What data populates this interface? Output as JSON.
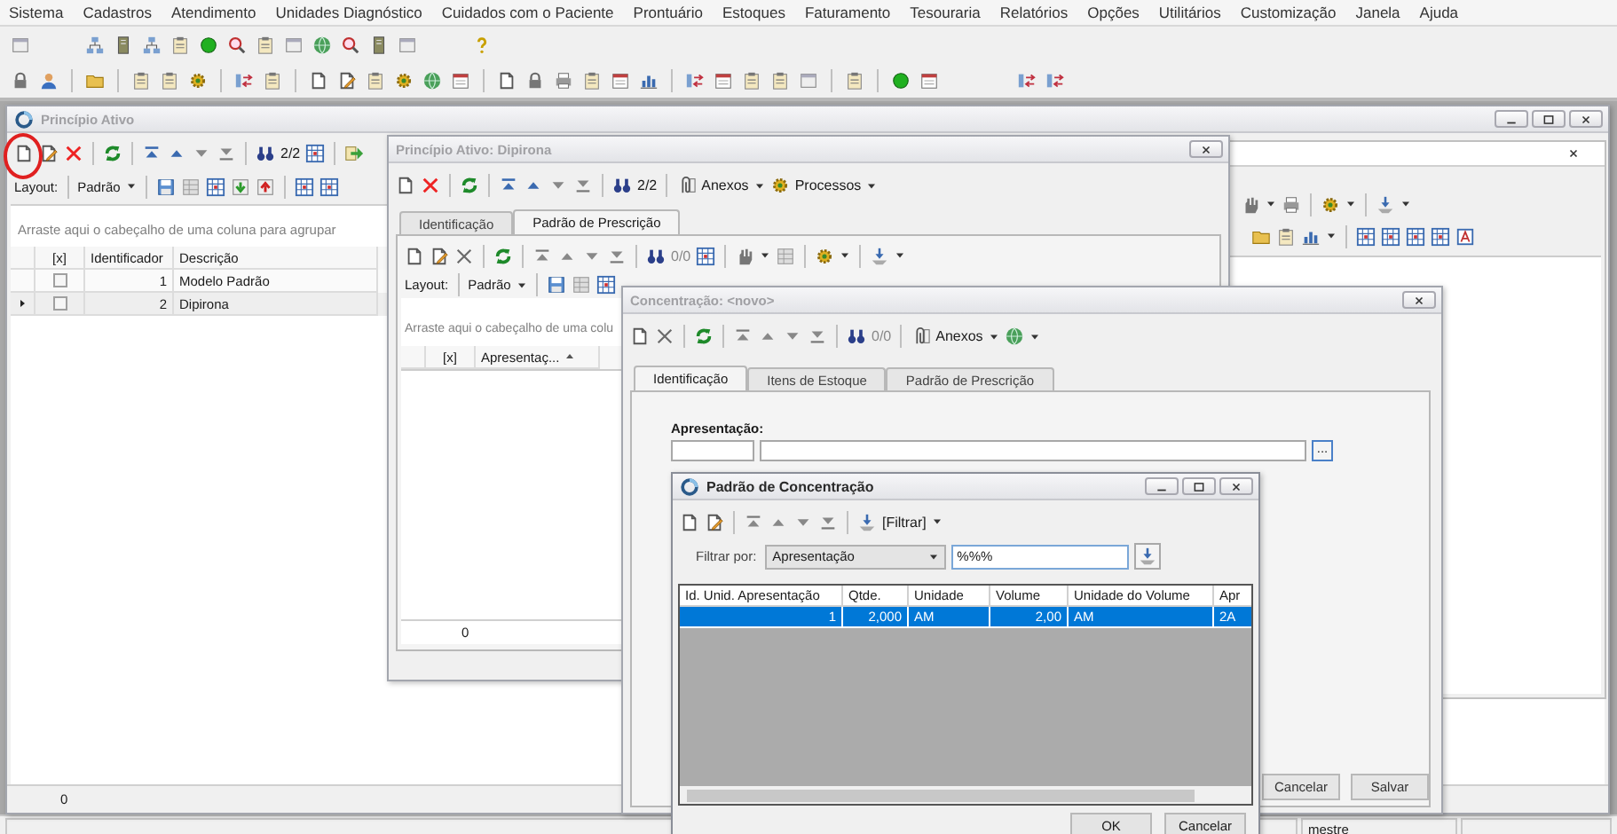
{
  "menu": [
    "Sistema",
    "Cadastros",
    "Atendimento",
    "Unidades Diagnóstico",
    "Cuidados com o Paciente",
    "Prontuário",
    "Estoques",
    "Faturamento",
    "Tesouraria",
    "Relatórios",
    "Opções",
    "Utilitários",
    "Customização",
    "Janela",
    "Ajuda"
  ],
  "main_window": {
    "title": "Princípio Ativo",
    "active": false,
    "counter": "2/2",
    "layout_label": "Layout:",
    "layout_value": "Padrão",
    "group_hint": "Arraste aqui o cabeçalho de uma coluna para agrupar",
    "columns": [
      "[x]",
      "Identificador",
      "Descrição"
    ],
    "rows": [
      {
        "checked": false,
        "id": "1",
        "description": "Modelo Padrão",
        "selected": false
      },
      {
        "checked": false,
        "id": "2",
        "description": "Dipirona",
        "selected": true
      }
    ],
    "footer": "0"
  },
  "detail_window": {
    "title": "Princípio Ativo: Dipirona",
    "active": false,
    "counter": "2/2",
    "attachments": "Anexos",
    "processes": "Processos",
    "tabs": [
      {
        "label": "Identificação",
        "selected": false
      },
      {
        "label": "Padrão de Prescrição",
        "selected": true
      }
    ],
    "sub_counter": "0/0",
    "layout_label": "Layout:",
    "layout_value": "Padrão",
    "group_hint": "Arraste aqui o cabeçalho de uma colu",
    "columns": [
      "[x]",
      "Apresentaç..."
    ],
    "footer": "0"
  },
  "concentration_window": {
    "title": "Concentração: <novo>",
    "active": false,
    "counter": "0/0",
    "attachments": "Anexos",
    "tabs": [
      {
        "label": "Identificação",
        "selected": true
      },
      {
        "label": "Itens de Estoque",
        "selected": false
      },
      {
        "label": "Padrão de Prescrição",
        "selected": false
      }
    ],
    "field_label": "Apresentação:",
    "browse_button": "...",
    "buttons": [
      "Cancelar",
      "Salvar"
    ]
  },
  "pattern_window": {
    "title": "Padrão de Concentração",
    "active": true,
    "filter_menu": "[Filtrar]",
    "filter_label": "Filtrar por:",
    "filter_field": "Apresentação",
    "filter_value": "%%%",
    "columns": [
      "Id. Unid. Apresentação",
      "Qtde.",
      "Unidade",
      "Volume",
      "Unidade do Volume",
      "Apr"
    ],
    "rows": [
      {
        "cells": [
          "1",
          "2,000",
          "AM",
          "2,00",
          "AM",
          "2A"
        ],
        "selected": true
      }
    ],
    "buttons": [
      "OK",
      "Cancelar"
    ]
  },
  "status_bar": {
    "text": "mestre"
  }
}
